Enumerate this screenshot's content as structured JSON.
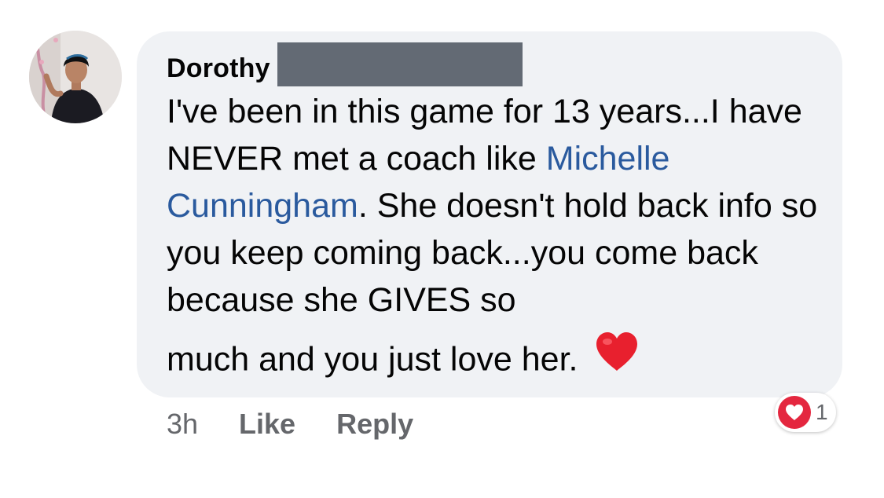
{
  "comment": {
    "author_name": "Dorothy",
    "text_before_mention": "I've been in this game for 13 years...I have NEVER met a coach like ",
    "mention": "Michelle Cunningham",
    "text_after_mention": ".  She doesn't hold back info so you keep coming back...you come back because she GIVES so",
    "last_line": "much and you just love her.",
    "emoji": "heart-emoji",
    "colors": {
      "bubble_bg": "#f0f2f5",
      "mention": "#2a5a9e",
      "redaction": "#636a74",
      "reaction_heart": "#e4273f"
    }
  },
  "actions": {
    "timestamp": "3h",
    "like_label": "Like",
    "reply_label": "Reply"
  },
  "reactions": {
    "icon": "heart-reaction-icon",
    "count": "1"
  }
}
